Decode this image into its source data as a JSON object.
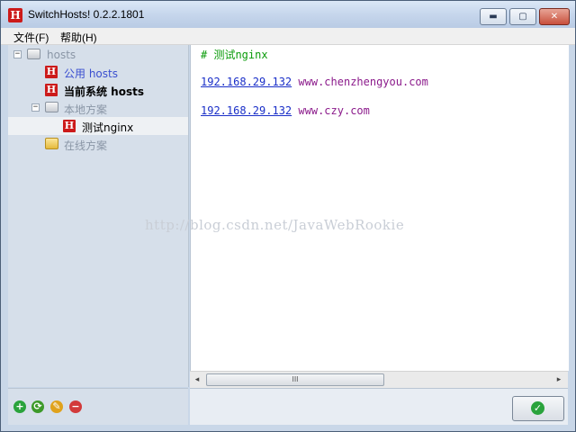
{
  "window": {
    "title": "SwitchHosts! 0.2.2.1801",
    "app_icon_glyph": "H",
    "buttons": {
      "minimize": "▬",
      "maximize": "▢",
      "close": "✕"
    }
  },
  "menu": {
    "file": "文件(F)",
    "help": "帮助(H)"
  },
  "tree": {
    "root": {
      "label": "hosts",
      "expander": "−",
      "icon": "folder-icon"
    },
    "items": [
      {
        "label": "公用 hosts",
        "icon": "hosts-h-icon",
        "color": "#3a4fd0"
      },
      {
        "label": "当前系统 hosts",
        "icon": "hosts-h-icon",
        "color": "#000000"
      }
    ],
    "local": {
      "label": "本地方案",
      "expander": "−",
      "icon": "folder-icon"
    },
    "local_items": [
      {
        "label": "测试nginx",
        "icon": "hosts-h-icon",
        "selected": true
      }
    ],
    "online": {
      "label": "在线方案",
      "icon": "folder-yellow-icon"
    }
  },
  "editor": {
    "lines": [
      {
        "comment": "# 测试nginx"
      },
      {
        "ip": "192.168.29.132",
        "domain": "www.chenzhengyou.com"
      },
      {
        "ip": "192.168.29.132",
        "domain": "www.czy.com"
      }
    ],
    "watermark": "http://blog.csdn.net/JavaWebRookie"
  },
  "scrollbar": {
    "left_arrow": "◂",
    "right_arrow": "▸",
    "grip": "III"
  },
  "toolbar": {
    "add_icon": "+",
    "refresh_icon": "⟳",
    "edit_icon": "✎",
    "delete_icon": "−",
    "ok_icon": "✓"
  },
  "colors": {
    "accent": "#cc1a1a",
    "comment": "#0a9b0a",
    "ip": "#1a2fc8",
    "domain": "#8b1a8b"
  }
}
